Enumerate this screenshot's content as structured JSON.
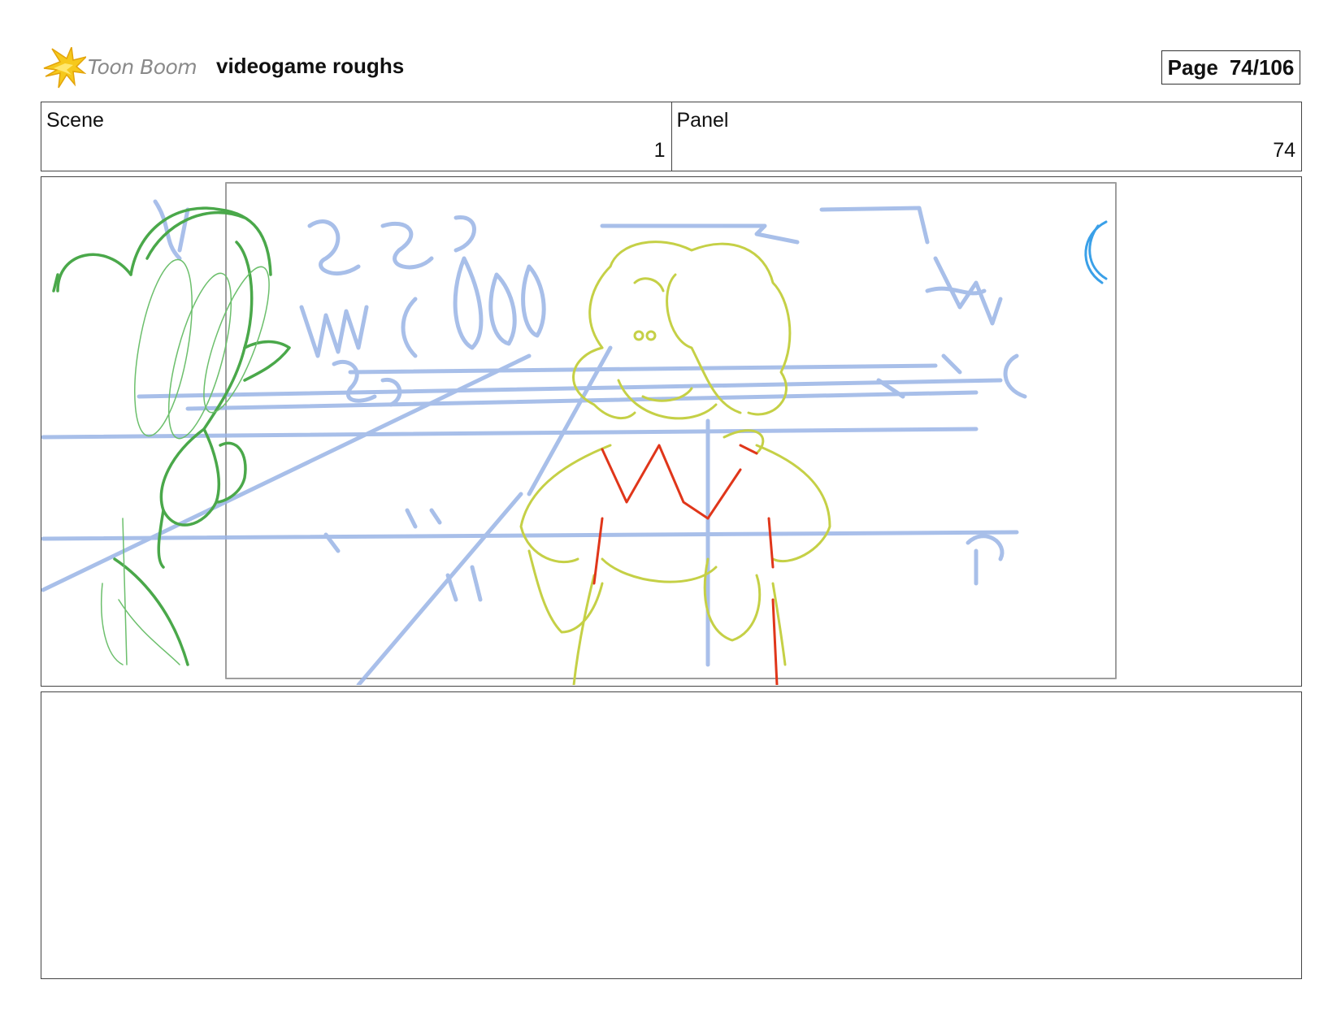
{
  "header": {
    "logo_text": "Toon Boom",
    "project_title": "videogame roughs",
    "page_label": "Page",
    "page_value": "74/106"
  },
  "info": {
    "scene_label": "Scene",
    "scene_value": "1",
    "panel_label": "Panel",
    "panel_value": "74"
  },
  "panel_image": {
    "subject": "rough storyboard sketch: girl with hands on hips in front of blue crowd lines, green plant on left",
    "colors": {
      "crowd_lines": "#9ab4e6",
      "character": "#c5d046",
      "collar": "#e0361a",
      "plant": "#4aa84a",
      "accent": "#3aa0e8",
      "camera_frame": "#9e9e9e"
    }
  },
  "notes": {
    "text": ""
  }
}
